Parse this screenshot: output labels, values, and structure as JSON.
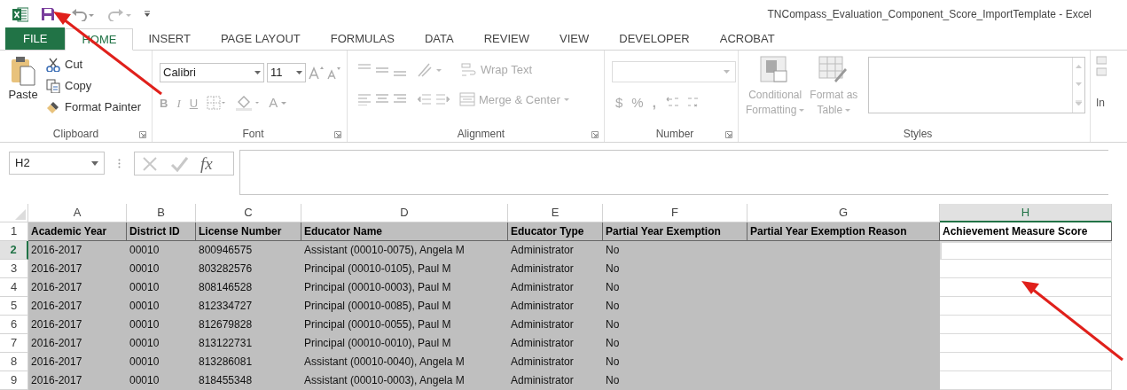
{
  "window": {
    "title": "TNCompass_Evaluation_Component_Score_ImportTemplate - Excel"
  },
  "tabs": [
    {
      "label": "FILE",
      "kind": "file",
      "selected": false
    },
    {
      "label": "HOME",
      "kind": "tab",
      "selected": true
    },
    {
      "label": "INSERT",
      "kind": "tab",
      "selected": false
    },
    {
      "label": "PAGE LAYOUT",
      "kind": "tab",
      "selected": false
    },
    {
      "label": "FORMULAS",
      "kind": "tab",
      "selected": false
    },
    {
      "label": "DATA",
      "kind": "tab",
      "selected": false
    },
    {
      "label": "REVIEW",
      "kind": "tab",
      "selected": false
    },
    {
      "label": "VIEW",
      "kind": "tab",
      "selected": false
    },
    {
      "label": "DEVELOPER",
      "kind": "tab",
      "selected": false
    },
    {
      "label": "ACROBAT",
      "kind": "tab",
      "selected": false
    }
  ],
  "ribbon": {
    "clipboard": {
      "label": "Clipboard",
      "paste": "Paste",
      "items": [
        {
          "label": "Cut",
          "kind": "cut"
        },
        {
          "label": "Copy",
          "kind": "copy"
        },
        {
          "label": "Format Painter",
          "kind": "painter"
        }
      ]
    },
    "font": {
      "label": "Font",
      "name": "Calibri",
      "size": "11",
      "styles": [
        "B",
        "I",
        "U"
      ],
      "color_letter": "A"
    },
    "alignment": {
      "label": "Alignment",
      "wrap": "Wrap Text",
      "merge": "Merge & Center"
    },
    "number": {
      "label": "Number",
      "symbols": [
        "$",
        "%",
        ","
      ]
    },
    "styles": {
      "label": "Styles",
      "buttons": [
        {
          "line1": "Conditional",
          "line2": "Formatting"
        },
        {
          "line1": "Format as",
          "line2": "Table"
        }
      ]
    },
    "cells": {
      "label": "In"
    }
  },
  "formula_bar": {
    "name_box": "H2",
    "fx": "fx"
  },
  "sheet": {
    "columns": [
      {
        "letter": "A",
        "shaded": true,
        "selected": false
      },
      {
        "letter": "B",
        "shaded": true,
        "selected": false
      },
      {
        "letter": "C",
        "shaded": true,
        "selected": false
      },
      {
        "letter": "D",
        "shaded": true,
        "selected": false
      },
      {
        "letter": "E",
        "shaded": true,
        "selected": false
      },
      {
        "letter": "F",
        "shaded": true,
        "selected": false
      },
      {
        "letter": "G",
        "shaded": true,
        "selected": false
      },
      {
        "letter": "H",
        "shaded": false,
        "selected": true
      }
    ],
    "rows": [
      {
        "number": "1",
        "kind": "header",
        "selected": false,
        "cells": [
          "Academic Year",
          "District ID",
          "License Number",
          "Educator Name",
          "Educator Type",
          "Partial Year Exemption",
          "Partial Year Exemption Reason",
          "Achievement Measure Score"
        ]
      },
      {
        "number": "2",
        "kind": "data",
        "selected": true,
        "cells": [
          "2016-2017",
          "00010",
          "800946575",
          "Assistant (00010-0075), Angela M",
          "Administrator",
          "No"
        ]
      },
      {
        "number": "3",
        "kind": "data",
        "selected": false,
        "cells": [
          "2016-2017",
          "00010",
          "803282576",
          "Principal (00010-0105), Paul M",
          "Administrator",
          "No"
        ]
      },
      {
        "number": "4",
        "kind": "data",
        "selected": false,
        "cells": [
          "2016-2017",
          "00010",
          "808146528",
          "Principal (00010-0003), Paul M",
          "Administrator",
          "No"
        ]
      },
      {
        "number": "5",
        "kind": "data",
        "selected": false,
        "cells": [
          "2016-2017",
          "00010",
          "812334727",
          "Principal (00010-0085), Paul M",
          "Administrator",
          "No"
        ]
      },
      {
        "number": "6",
        "kind": "data",
        "selected": false,
        "cells": [
          "2016-2017",
          "00010",
          "812679828",
          "Principal (00010-0055), Paul M",
          "Administrator",
          "No"
        ]
      },
      {
        "number": "7",
        "kind": "data",
        "selected": false,
        "cells": [
          "2016-2017",
          "00010",
          "813122731",
          "Principal (00010-0010), Paul M",
          "Administrator",
          "No"
        ]
      },
      {
        "number": "8",
        "kind": "data",
        "selected": false,
        "cells": [
          "2016-2017",
          "00010",
          "813286081",
          "Assistant (00010-0040), Angela M",
          "Administrator",
          "No"
        ]
      },
      {
        "number": "9",
        "kind": "data",
        "selected": false,
        "cells": [
          "2016-2017",
          "00010",
          "818455348",
          "Assistant (00010-0003), Angela M",
          "Administrator",
          "No"
        ]
      }
    ]
  }
}
